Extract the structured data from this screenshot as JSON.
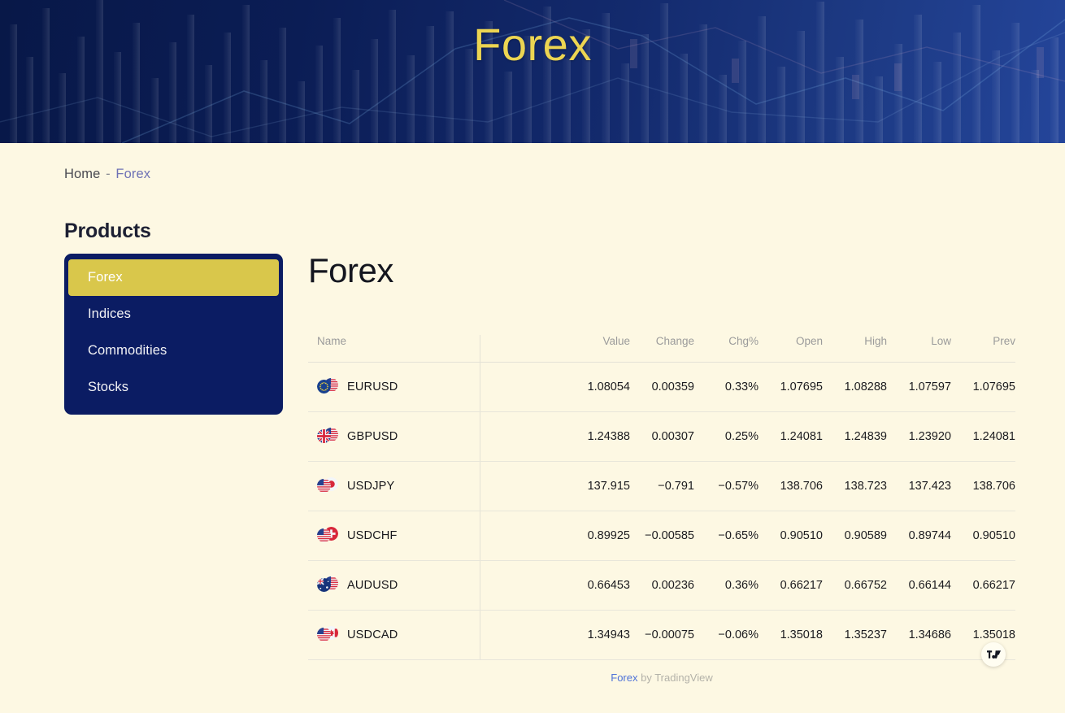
{
  "hero": {
    "title": "Forex",
    "title_color": "#ecd552",
    "bg_start": "#081848",
    "bg_end": "#24459a"
  },
  "breadcrumb": {
    "home": "Home",
    "separator": "-",
    "current": "Forex"
  },
  "sidebar": {
    "heading": "Products",
    "items": [
      {
        "label": "Forex",
        "active": true
      },
      {
        "label": "Indices",
        "active": false
      },
      {
        "label": "Commodities",
        "active": false
      },
      {
        "label": "Stocks",
        "active": false
      }
    ],
    "active_color": "#d9c74b",
    "panel_color": "#0b1c63"
  },
  "main": {
    "title": "Forex"
  },
  "table": {
    "columns": [
      "Name",
      "Value",
      "Change",
      "Chg%",
      "Open",
      "High",
      "Low",
      "Prev"
    ],
    "rows": [
      {
        "symbol": "EURUSD",
        "base": "eu",
        "quote": "us",
        "value": "1.08054",
        "change": "0.00359",
        "chg_pct": "0.33%",
        "direction": "up",
        "open": "1.07695",
        "high": "1.08288",
        "low": "1.07597",
        "prev": "1.07695"
      },
      {
        "symbol": "GBPUSD",
        "base": "gb",
        "quote": "us",
        "value": "1.24388",
        "change": "0.00307",
        "chg_pct": "0.25%",
        "direction": "up",
        "open": "1.24081",
        "high": "1.24839",
        "low": "1.23920",
        "prev": "1.24081"
      },
      {
        "symbol": "USDJPY",
        "base": "us",
        "quote": "jp",
        "value": "137.915",
        "change": "−0.791",
        "chg_pct": "−0.57%",
        "direction": "down",
        "open": "138.706",
        "high": "138.723",
        "low": "137.423",
        "prev": "138.706"
      },
      {
        "symbol": "USDCHF",
        "base": "us",
        "quote": "ch",
        "value": "0.89925",
        "change": "−0.00585",
        "chg_pct": "−0.65%",
        "direction": "down",
        "open": "0.90510",
        "high": "0.90589",
        "low": "0.89744",
        "prev": "0.90510"
      },
      {
        "symbol": "AUDUSD",
        "base": "au",
        "quote": "us",
        "value": "0.66453",
        "change": "0.00236",
        "chg_pct": "0.36%",
        "direction": "up",
        "open": "0.66217",
        "high": "0.66752",
        "low": "0.66144",
        "prev": "0.66217"
      },
      {
        "symbol": "USDCAD",
        "base": "us",
        "quote": "ca",
        "value": "1.34943",
        "change": "−0.00075",
        "chg_pct": "−0.06%",
        "direction": "down",
        "open": "1.35018",
        "high": "1.35237",
        "low": "1.34686",
        "prev": "1.35018"
      }
    ],
    "positive_color": "#0a9981",
    "negative_color": "#f06a72"
  },
  "footer": {
    "link_text": "Forex",
    "suffix": " by TradingView"
  }
}
